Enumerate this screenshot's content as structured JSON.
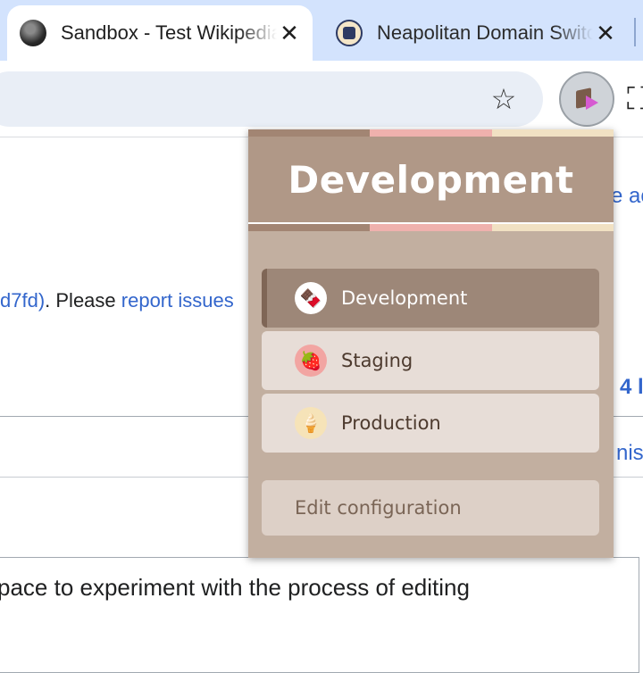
{
  "tabs": [
    {
      "title": "Sandbox - Test Wikipedia",
      "icon": "wikipedia-globe-icon",
      "active": true,
      "close_glyph": "✕"
    },
    {
      "title": "Neapolitan Domain Switcher",
      "icon": "neapolitan-extension-icon",
      "active": false,
      "close_glyph": "✕"
    }
  ],
  "toolbar": {
    "bookmark_icon": "star-icon",
    "bookmark_glyph": "☆",
    "extension_icon": "neapolitan-extension-icon",
    "extensions_menu_icon": "puzzle-icon",
    "extensions_menu_glyph": "⛶"
  },
  "page": {
    "fragment_top_right": "e ac",
    "line_prefix_link": "d7fd)",
    "line_middle": ". Please ",
    "line_link": "report issues",
    "fragment_mid_right": "4 l",
    "fragment_lower_right": "nisto",
    "editor_text": "pace to experiment with the process of editing"
  },
  "popup": {
    "title": "Development",
    "environments": [
      {
        "label": "Development",
        "icon": "chocolate-icon",
        "emoji": "🍫",
        "selected": true
      },
      {
        "label": "Staging",
        "icon": "strawberry-icon",
        "emoji": "🍓",
        "selected": false
      },
      {
        "label": "Production",
        "icon": "ice-cream-icon",
        "emoji": "🍦",
        "selected": false
      }
    ],
    "edit_configuration_label": "Edit configuration"
  },
  "colors": {
    "chocolate": "#b09887",
    "strawberry": "#efb1ad",
    "vanilla": "#f1e1c3",
    "tab_strip": "#d3e3fd",
    "link": "#3366cc"
  }
}
